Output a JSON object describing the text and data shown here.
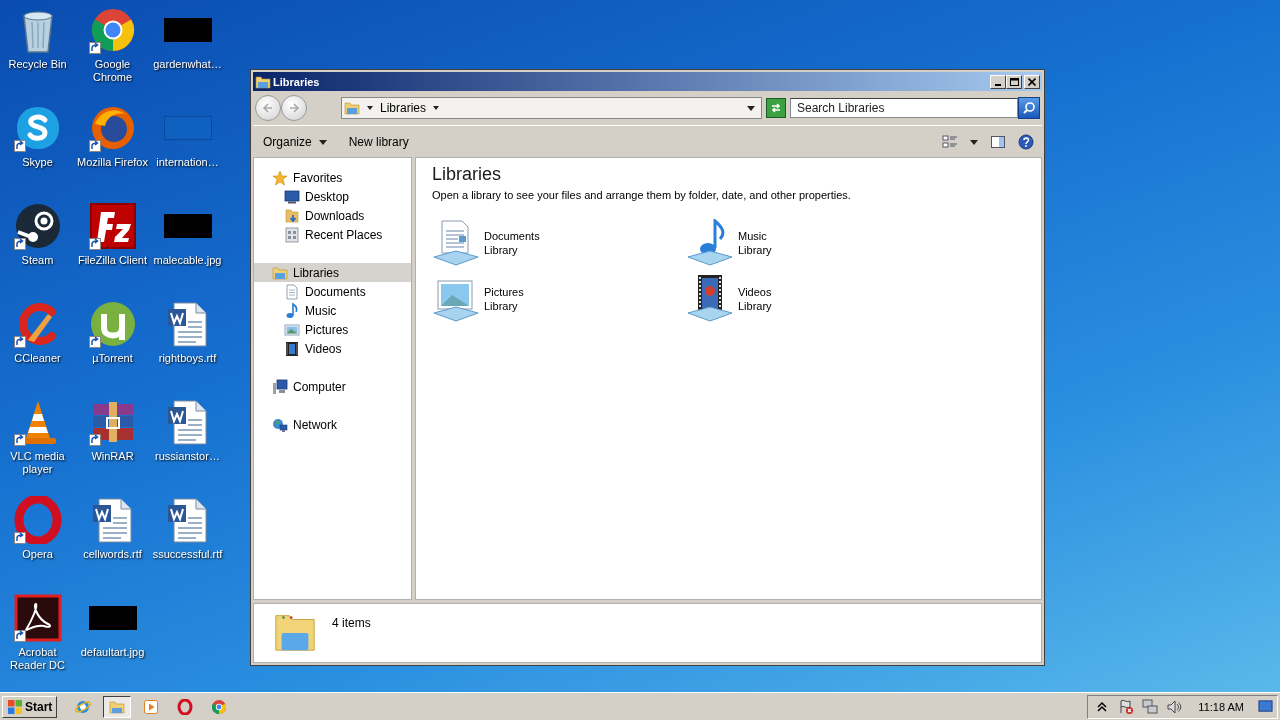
{
  "desktop": {
    "icons": [
      {
        "label": "Recycle Bin",
        "kind": "recycle-bin",
        "shortcut": false
      },
      {
        "label": "Skype",
        "kind": "skype",
        "shortcut": true
      },
      {
        "label": "Steam",
        "kind": "steam",
        "shortcut": true
      },
      {
        "label": "CCleaner",
        "kind": "ccleaner",
        "shortcut": true
      },
      {
        "label": "VLC media player",
        "kind": "vlc",
        "shortcut": true
      },
      {
        "label": "Opera",
        "kind": "opera",
        "shortcut": true
      },
      {
        "label": "Acrobat Reader DC",
        "kind": "acrobat",
        "shortcut": true
      },
      {
        "label": "Google Chrome",
        "kind": "chrome",
        "shortcut": true
      },
      {
        "label": "Mozilla Firefox",
        "kind": "firefox",
        "shortcut": true
      },
      {
        "label": "FileZilla Client",
        "kind": "filezilla",
        "shortcut": true
      },
      {
        "label": "µTorrent",
        "kind": "utorrent",
        "shortcut": true
      },
      {
        "label": "WinRAR",
        "kind": "winrar",
        "shortcut": true
      },
      {
        "label": "cellwords.rtf",
        "kind": "document",
        "shortcut": false
      },
      {
        "label": "defaultart.jpg",
        "kind": "image",
        "shortcut": false
      },
      {
        "label": "gardenwhat…",
        "kind": "image",
        "shortcut": false
      },
      {
        "label": "internation…",
        "kind": "dim-image",
        "shortcut": false
      },
      {
        "label": "malecable.jpg",
        "kind": "image",
        "shortcut": false
      },
      {
        "label": "rightboys.rtf",
        "kind": "document",
        "shortcut": false
      },
      {
        "label": "russianstor…",
        "kind": "document",
        "shortcut": false
      },
      {
        "label": "ssuccessful.rtf",
        "kind": "document",
        "shortcut": false
      }
    ]
  },
  "window": {
    "title": "Libraries",
    "address": {
      "location": "Libraries",
      "search_placeholder": "Search Libraries"
    },
    "toolbar": [
      {
        "label": "Organize",
        "dropdown": true
      },
      {
        "label": "New library",
        "dropdown": false
      }
    ],
    "navigation": [
      {
        "label": "Favorites",
        "kind": "star",
        "selected": false,
        "children": [
          {
            "label": "Desktop",
            "kind": "desktop",
            "selected": false
          },
          {
            "label": "Downloads",
            "kind": "downloads",
            "selected": false
          },
          {
            "label": "Recent Places",
            "kind": "recent",
            "selected": false
          }
        ]
      },
      {
        "label": "Libraries",
        "kind": "libraries",
        "selected": true,
        "children": [
          {
            "label": "Documents",
            "kind": "document",
            "selected": false
          },
          {
            "label": "Music",
            "kind": "music",
            "selected": false
          },
          {
            "label": "Pictures",
            "kind": "pictures",
            "selected": false
          },
          {
            "label": "Videos",
            "kind": "videos",
            "selected": false
          }
        ]
      },
      {
        "label": "Computer",
        "kind": "computer",
        "selected": false
      },
      {
        "label": "Network",
        "kind": "network",
        "selected": false
      }
    ],
    "content": {
      "heading": "Libraries",
      "description": "Open a library to see your files and arrange them by folder, date, and other properties.",
      "items": [
        {
          "name": "Documents",
          "type": "Library",
          "kind": "document"
        },
        {
          "name": "Music",
          "type": "Library",
          "kind": "music"
        },
        {
          "name": "Pictures",
          "type": "Library",
          "kind": "pictures"
        },
        {
          "name": "Videos",
          "type": "Library",
          "kind": "videos"
        }
      ]
    },
    "status": "4 items"
  },
  "taskbar": {
    "start": "Start",
    "apps": [
      {
        "kind": "ie",
        "selected": false
      },
      {
        "kind": "explorer",
        "selected": true
      },
      {
        "kind": "media",
        "selected": false
      },
      {
        "kind": "opera",
        "selected": false
      },
      {
        "kind": "chrome",
        "selected": false
      }
    ],
    "tray": [
      {
        "kind": "chevron"
      },
      {
        "kind": "flag"
      },
      {
        "kind": "network"
      },
      {
        "kind": "speaker"
      }
    ],
    "clock": "11:18 AM"
  }
}
